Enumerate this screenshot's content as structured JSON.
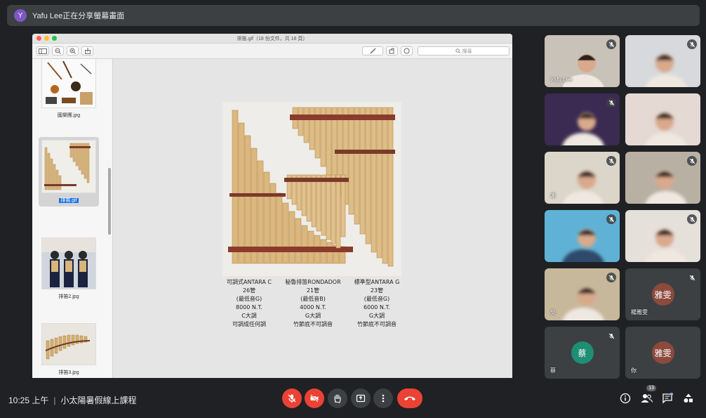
{
  "banner": {
    "avatar_letter": "Y",
    "text": "Yafu Lee正在分享螢幕畫面"
  },
  "preview": {
    "window_title": "排笛.gif（18 份文件，共 18 頁）",
    "search_placeholder": "搜尋",
    "thumbnails": [
      {
        "caption": "國樂團.jpg",
        "selected": false
      },
      {
        "caption": "排笛.gif",
        "selected": true
      },
      {
        "caption": "排笛2.jpg",
        "selected": false
      },
      {
        "caption": "排笛3.jpg",
        "selected": false
      }
    ],
    "captions": [
      {
        "l1": "可調式ANTARA C",
        "l2": "26管",
        "l3": "(最低音G)",
        "l4": "8000 N.T.",
        "l5": "C大調",
        "l6": "可調成任何調"
      },
      {
        "l1": "秘魯排笛RONDADOR",
        "l2": "21管",
        "l3": "(最低音B)",
        "l4": "4000 N.T.",
        "l5": "G大調",
        "l6": "竹節底不可調音"
      },
      {
        "l1": "標準型ANTARA G",
        "l2": "23管",
        "l3": "(最低音G)",
        "l4": "6000 N.T.",
        "l5": "G大調",
        "l6": "竹節底不可調音"
      }
    ]
  },
  "participants": [
    {
      "name": "Yafu Lee",
      "muted": true
    },
    {
      "name": "",
      "muted": true
    },
    {
      "name": "",
      "muted": true
    },
    {
      "name": "",
      "muted": false
    },
    {
      "name": "謝",
      "muted": true
    },
    {
      "name": "",
      "muted": true
    },
    {
      "name": "",
      "muted": true
    },
    {
      "name": "",
      "muted": true
    },
    {
      "name": "吳",
      "muted": true
    },
    {
      "name": "楊雅雯",
      "muted": true,
      "avatar_text": "雅雯"
    },
    {
      "name": "蔡",
      "muted": true,
      "avatar_text": "蔡"
    },
    {
      "name": "你",
      "muted": false,
      "avatar_text": "雅雯"
    }
  ],
  "bottom_bar": {
    "time": "10:25 上午",
    "meeting_name": "小太陽暑假線上課程",
    "people_count": "13"
  },
  "colors": {
    "danger": "#ea4335",
    "surface": "#3c4043",
    "background": "#202124"
  },
  "icons": [
    "mic-off-icon",
    "camera-off-icon",
    "raise-hand-icon",
    "present-icon",
    "more-icon",
    "hangup-icon",
    "info-icon",
    "people-icon",
    "chat-icon",
    "activities-icon"
  ]
}
